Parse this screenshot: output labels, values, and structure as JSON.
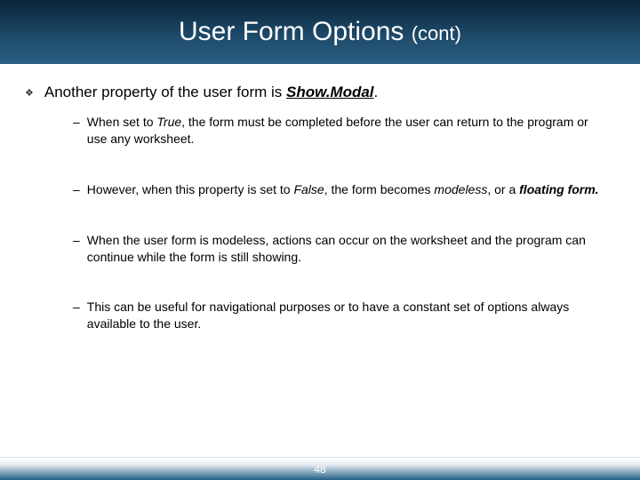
{
  "header": {
    "title_main": "User Form Options ",
    "title_suffix": "(cont)"
  },
  "bullet": {
    "lead_text": "Another property of the user form is ",
    "property_name": "Show.Modal",
    "trail_text": "."
  },
  "subs": [
    {
      "pre": "When set to ",
      "em1": "True",
      "post1": ", the form must be completed before the user can return to the program or use any worksheet."
    },
    {
      "pre": "However, when this property is set to ",
      "em1": "False",
      "mid": ", the form becomes ",
      "em2": "modeless",
      "mid2": ", or a ",
      "em3": "floating form."
    },
    {
      "pre": "When the user form is modeless, actions can occur on the worksheet and the program can continue while the form is still showing."
    },
    {
      "pre": "This can be useful for navigational purposes or to have a constant set of options always available to the user."
    }
  ],
  "footer": {
    "page_number": "48"
  }
}
